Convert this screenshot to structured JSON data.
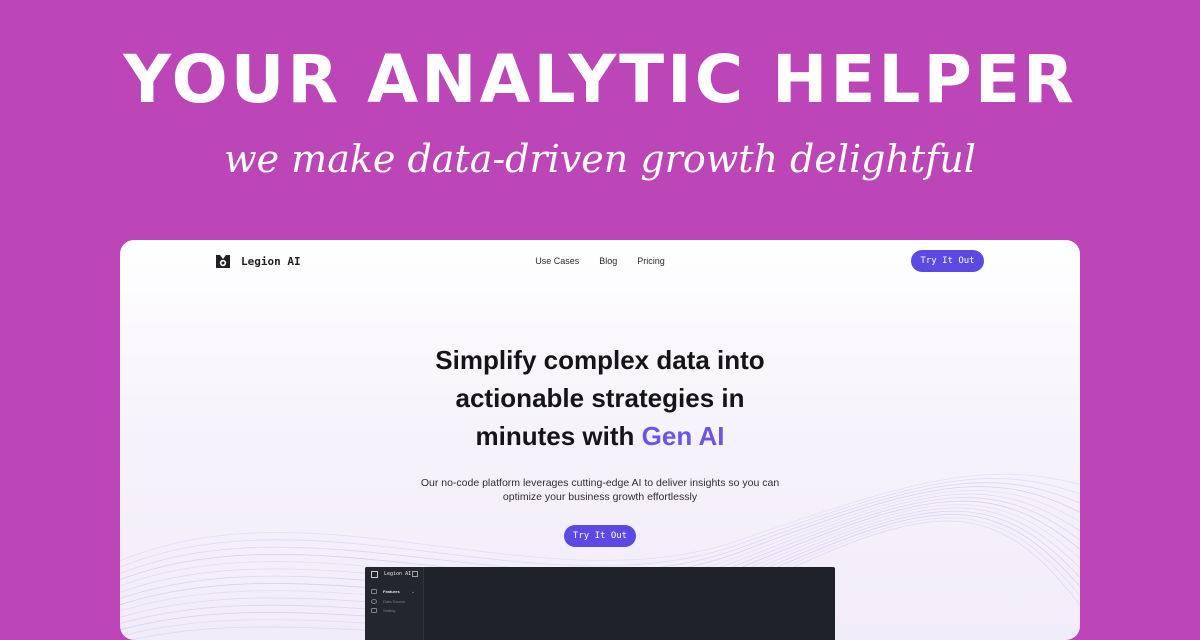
{
  "banner": {
    "title": "YOUR ANALYTIC HELPER",
    "subtitle": "we make data-driven growth delightful"
  },
  "nav": {
    "brand": "Legion AI",
    "links": [
      "Use Cases",
      "Blog",
      "Pricing"
    ],
    "cta_label": "Try It Out"
  },
  "hero": {
    "title_line1": "Simplify complex data into",
    "title_line2": "actionable strategies in",
    "title_line3_prefix": "minutes with ",
    "title_accent": "Gen AI",
    "description_line1": "Our no-code platform leverages cutting-edge AI to deliver insights so you can",
    "description_line2": "optimize your business growth effortlessly",
    "cta_label": "Try It Out"
  },
  "app_preview": {
    "brand": "Legion AI",
    "sidebar_items": [
      {
        "label": "Features",
        "active": true
      },
      {
        "label": "Data Source",
        "active": false
      },
      {
        "label": "Setting",
        "active": false
      }
    ]
  },
  "colors": {
    "background": "#bc45b8",
    "accent": "#5a4ae3",
    "accent_text": "#6a55e6",
    "app_dark": "#1e2127"
  },
  "icons": [
    "legion-logo-icon",
    "sidebar-collapse-icon",
    "features-icon",
    "data-source-icon",
    "setting-icon",
    "chevron-down-icon"
  ]
}
